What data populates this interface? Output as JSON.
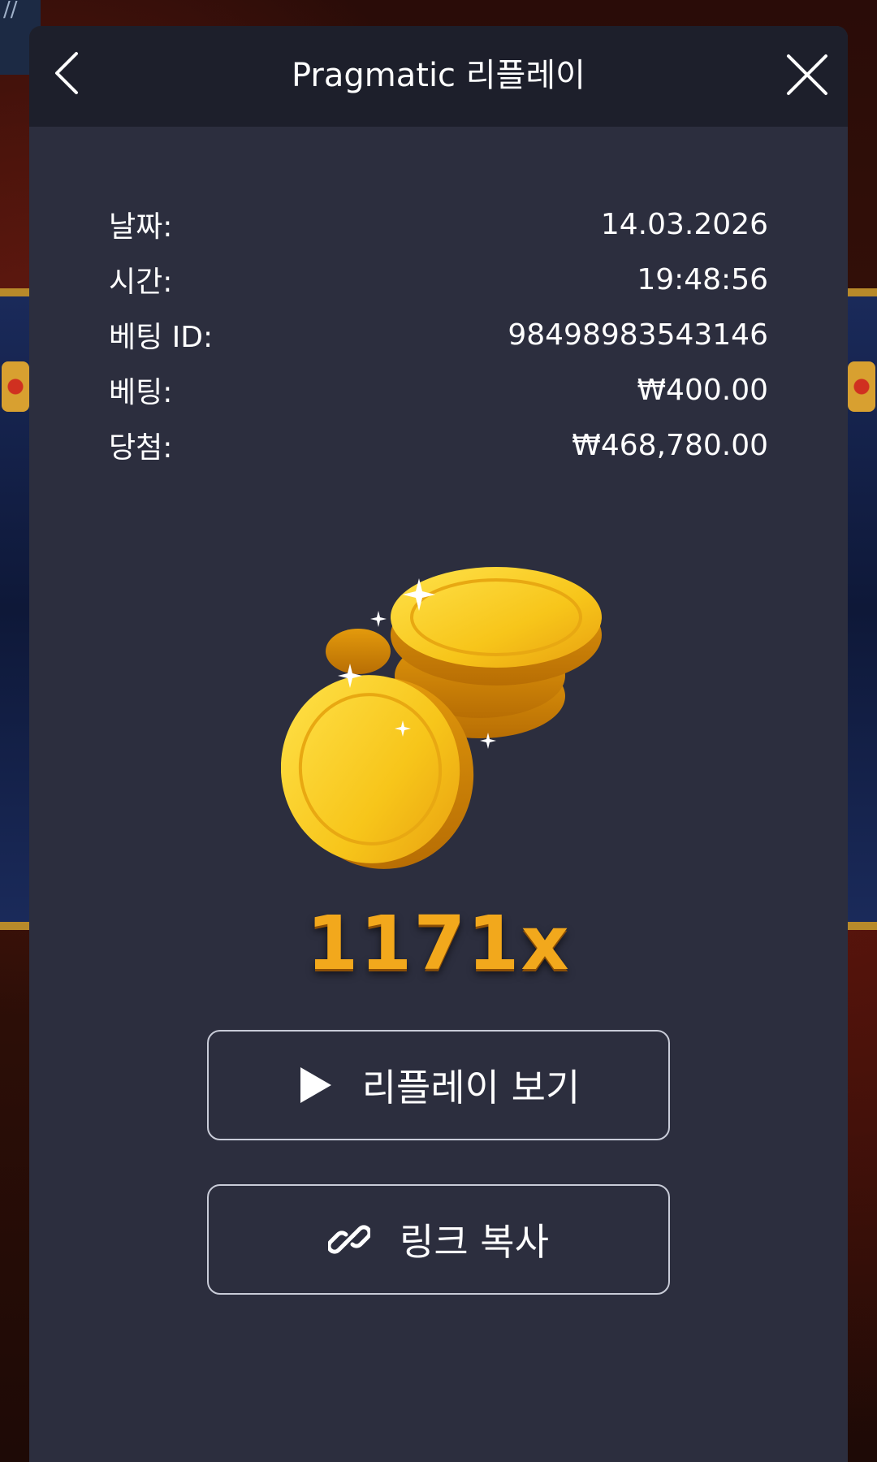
{
  "background": {
    "corner_glyph": "//"
  },
  "header": {
    "title": "Pragmatic 리플레이",
    "back_icon": "chevron-left-icon",
    "close_icon": "close-icon"
  },
  "info": [
    {
      "label": "날짜:",
      "value": "14.03.2026"
    },
    {
      "label": "시간:",
      "value": "19:48:56"
    },
    {
      "label": "베팅 ID:",
      "value": "98498983543146"
    },
    {
      "label": "베팅:",
      "value": "₩400.00"
    },
    {
      "label": "당첨:",
      "value": "₩468,780.00"
    }
  ],
  "win": {
    "image": "gold-coins-icon",
    "multiplier": "1171x"
  },
  "buttons": {
    "replay_label": "리플레이 보기",
    "replay_icon": "play-icon",
    "copy_label": "링크 복사",
    "copy_icon": "link-icon"
  },
  "colors": {
    "modal_bg": "#2c2e3e",
    "header_bg": "#1d1f2b",
    "multiplier": "#f2a81c",
    "coin_gold": "#f5c21a"
  }
}
